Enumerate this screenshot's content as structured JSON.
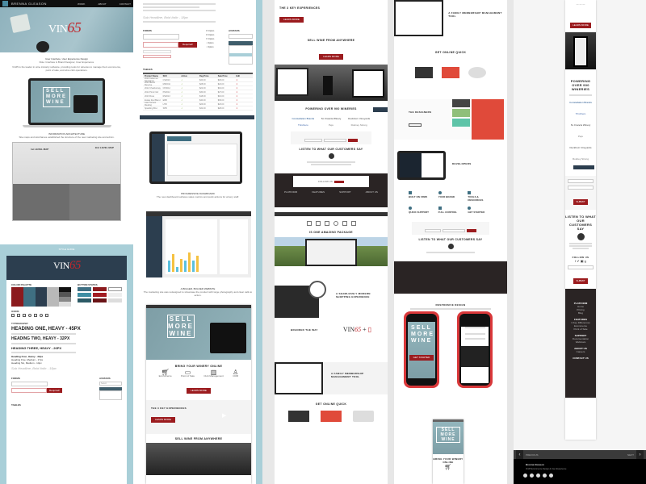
{
  "column1": {
    "topbar": {
      "brand": "BRENNA GLEASON",
      "nav": [
        "WORK",
        "ABOUT",
        "CONTACT"
      ]
    },
    "hero": {
      "logo_text": "VIN",
      "logo_accent": "65"
    },
    "intro": {
      "title": "User Interface, User Experience Design",
      "subtitle": "Role: Interface & Brand Designer, User Experience",
      "body": "Vin65 is the leader in wine industry software, providing tools for wineries to manage their ecommerce, point of sale, and wine club operations."
    },
    "laptop_hero": {
      "headline": [
        "SELL",
        "MORE",
        "WINE"
      ]
    },
    "architecture": {
      "title": "INFORMATION ARCHITECTURE",
      "body": "Site maps and wireframes established the structure of the new marketing site and admin.",
      "map_labels": [
        "1st LEVEL MAP",
        "2nd LEVEL MAP"
      ]
    },
    "style_guide": {
      "title": "STYLE GUIDE",
      "logo_text": "VIN",
      "logo_accent": "65",
      "sections": [
        "COLOR PALETTE",
        "BUTTON STATES",
        "ICONS",
        "AVATARS",
        "TYPOGRAPHY"
      ],
      "headings": [
        "HEADING ONE, HEAVY - 45PX",
        "HEADING TWO, HEAVY - 32PX",
        "HEADING THREE, HEAVY - 26PX",
        "Heading Four, Heavy - 22px",
        "Heading Five, Medium - 17px",
        "Heading Six, Medium - 14px",
        "Sub Headline, Bold Italic - 18px"
      ],
      "form_label": "FORMS",
      "select_label": "SELECT OPTIONS",
      "required_label": "Required!",
      "select_placeholder": "Select",
      "table_label": "TABLES"
    },
    "colors": [
      "#8b1a1d",
      "#3f6f82",
      "#2c3e4f",
      "#b9b9b9",
      "#111111",
      "#a9cfd8",
      "#ffffff"
    ]
  },
  "column2": {
    "table": {
      "headers": [
        "Product Name",
        "SKU",
        "Active",
        "Reg Price",
        "Sale Price",
        "Edit"
      ],
      "rows": [
        [
          "2010 Cabernet Sauvignon",
          "CS2010",
          "✓",
          "$34.00",
          "$29.00",
          "✕"
        ],
        [
          "2011 Merlot Reserve",
          "MR2011",
          "✓",
          "$28.00",
          "$24.00",
          "✕"
        ],
        [
          "2012 Chardonnay",
          "CH2012",
          "✓",
          "$22.00",
          "$19.00",
          "✕"
        ],
        [
          "2012 Pinot Noir",
          "PN2012",
          "✓",
          "$30.00",
          "$27.00",
          "✕"
        ],
        [
          "2013 Rosé",
          "RS2013",
          "✓",
          "$18.00",
          "$16.00",
          "✕"
        ],
        [
          "Estate Red Blend",
          "ERB",
          "✓",
          "$40.00",
          "$36.00",
          "✕"
        ],
        [
          "Late Harvest Riesling",
          "LHR",
          "✓",
          "$26.00",
          "$23.00",
          "✕"
        ],
        [
          "Sparkling Brut",
          "SPB",
          "✓",
          "$32.00",
          "$28.00",
          "✕"
        ]
      ]
    },
    "admin": {
      "title": "PROGRESSIVE DASHBOARD",
      "body": "The new dashboard surfaces sales metrics and quick actions for winery staff."
    },
    "bigger": {
      "title": "A BIGGER, BOLDER WEBSITE",
      "body": "The marketing site was redesigned to showcase the product with large photography and clear calls to action."
    },
    "website": {
      "hero_lines": [
        "SELL",
        "MORE",
        "WINE"
      ],
      "sections": [
        "BRING YOUR WINERY ONLINE",
        "THE 3 KEY EXPERIENCES",
        "SELL WINE FROM ANYWHERE"
      ],
      "features": [
        "Ecommerce",
        "Point of Sale",
        "Club Management",
        "CRM"
      ],
      "cta": "LEARN MORE"
    }
  },
  "column3": {
    "sections": [
      "THE 3 KEY EXPERIENCES",
      "SELL WINE FROM ANYWHERE",
      "POWERING OVER 900 WINERIES",
      "LISTEN TO WHAT OUR CUSTOMERS SAY",
      "IS ONE AMAZING PACKAGE",
      "A SEAMLESSLY MODERN SHOPPING EXPERIENCE",
      "BRANDED THE WAY",
      "A FAMILY MEMBERSHIP MANAGEMENT TOOL",
      "GET ONLINE QUICK"
    ],
    "partners": [
      "Constellation Brands",
      "St. Francis Winery",
      "Duckhorn Vineyards",
      "Trinchero",
      "Peju",
      "Rodney Strong"
    ],
    "cta": "SUBMIT",
    "follow": "FOLLOW US",
    "footer_cols": [
      "PLATFORM",
      "FEATURES",
      "SUPPORT",
      "ABOUT US"
    ]
  },
  "column4": {
    "sections": [
      "A FAMILY MEMBERSHIP MANAGEMENT TOOL",
      "GET ONLINE QUICK",
      "THE DESIGNERS",
      "DEVELOPERS",
      "LISTEN TO WHAT OUR CUSTOMERS SAY",
      "RESPONSIVE DESIGN",
      "BRING YOUR WINERY ONLINE"
    ],
    "features": [
      "BUILT ON VIN65",
      "YOUR BRAND",
      "TOOLS & RESOURCES",
      "QUICK SUPPORT",
      "FULL CONTROL",
      "GET STARTED"
    ],
    "phone_cta": "GET STARTED"
  },
  "column5": {
    "sections": [
      "POWERING OVER 900 WINERIES",
      "LISTEN TO WHAT OUR CUSTOMERS SAY",
      "FOLLOW US"
    ],
    "cta": "LEARN MORE",
    "submit": "SUBMIT",
    "footer": {
      "platform": [
        "Home",
        "Pricing",
        "Blog",
        "Demo"
      ],
      "features": [
        "3 Key Differences",
        "Ecommerce",
        "Point of Sale",
        "Club Management",
        "CRM"
      ],
      "support": [
        "Documentation",
        "Webinars",
        "Technical Support",
        "Training",
        "Partner Portal"
      ],
      "about": [
        "Careers",
        "Press"
      ],
      "contact": "CONTACT US"
    }
  },
  "viewer": {
    "prev_label": "PREVIOUS",
    "next_label": "NEXT",
    "author": "Brenna Gleason",
    "caption": "Vin65 Ecommerce Design & User Experience",
    "social": [
      "dribbble",
      "behance",
      "linkedin",
      "twitter",
      "pinterest"
    ]
  }
}
